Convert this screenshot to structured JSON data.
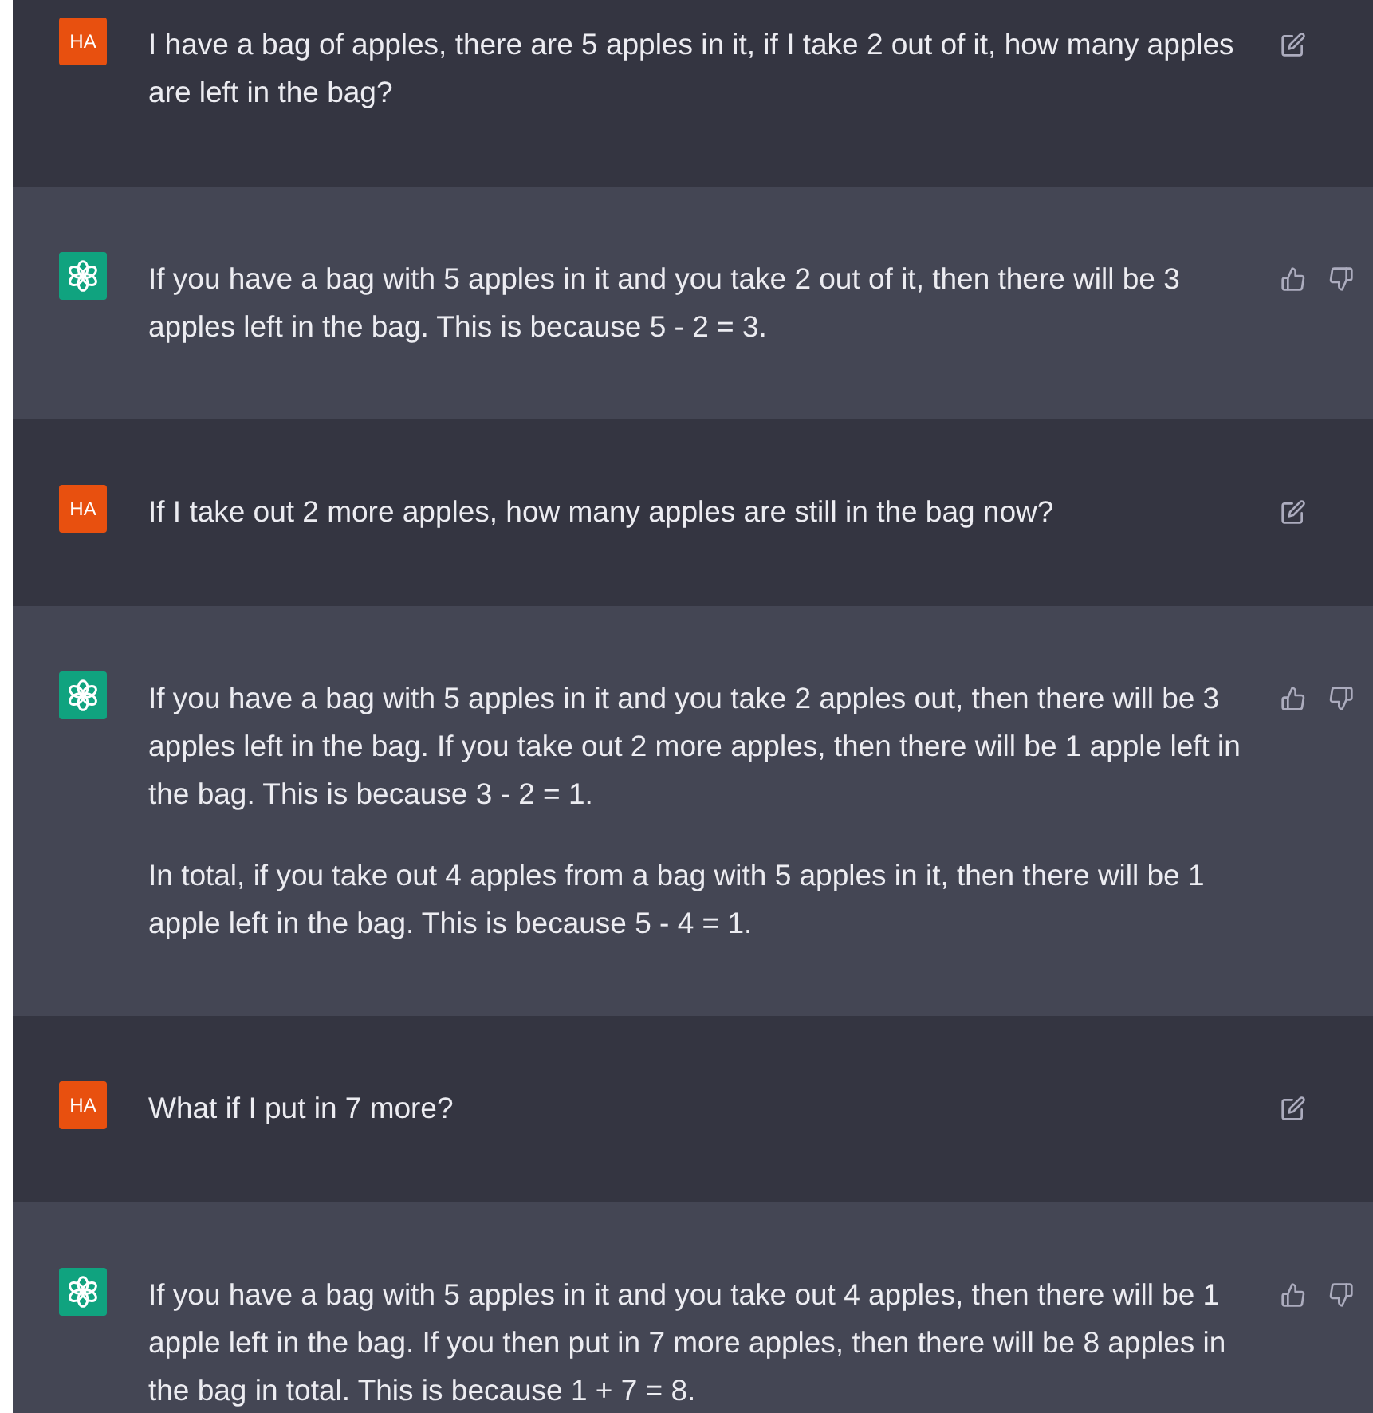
{
  "messages": [
    {
      "kind": "user",
      "avatar": "HA",
      "paragraphs": [
        "I have a bag of apples, there are 5 apples in it, if I take 2 out of it, how many apples are left in the bag?"
      ]
    },
    {
      "kind": "assistant",
      "paragraphs": [
        "If you have a bag with 5 apples in it and you take 2 out of it, then there will be 3 apples left in the bag. This is because 5 - 2 = 3."
      ]
    },
    {
      "kind": "user",
      "avatar": "HA",
      "paragraphs": [
        "If I take out 2 more apples, how many apples are still in the bag now?"
      ]
    },
    {
      "kind": "assistant",
      "paragraphs": [
        "If you have a bag with 5 apples in it and you take 2 apples out, then there will be 3 apples left in the bag. If you take out 2 more apples, then there will be 1 apple left in the bag. This is because 3 - 2 = 1.",
        "In total, if you take out 4 apples from a bag with 5 apples in it, then there will be 1 apple left in the bag. This is because 5 - 4 = 1."
      ]
    },
    {
      "kind": "user",
      "avatar": "HA",
      "paragraphs": [
        "What if I put in 7 more?"
      ]
    },
    {
      "kind": "assistant",
      "paragraphs": [
        "If you have a bag with 5 apples in it and you take out 4 apples, then there will be 1 apple left in the bag. If you then put in 7 more apples, then there will be 8 apples in the bag in total. This is because 1 + 7 = 8."
      ]
    }
  ]
}
